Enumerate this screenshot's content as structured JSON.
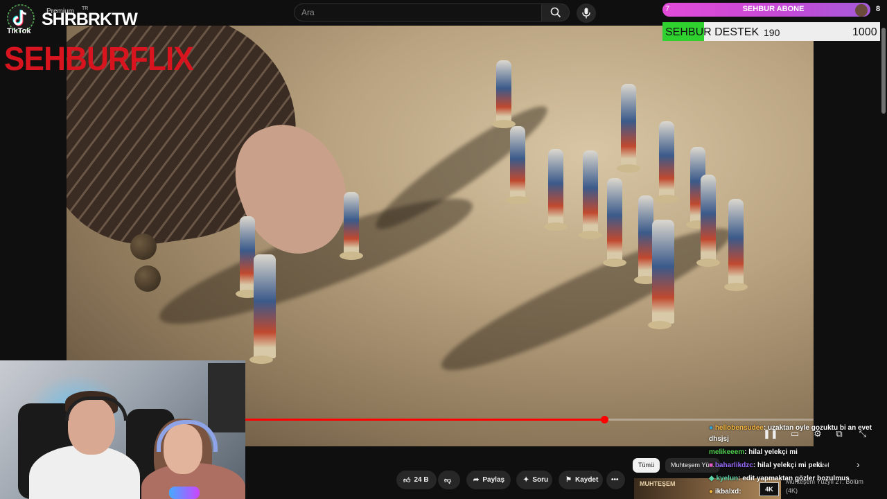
{
  "header": {
    "search_placeholder": "Ara",
    "search_icon": "search-icon",
    "mic_icon": "mic-icon"
  },
  "overlay": {
    "tiktok_name": "SHRBRKTW",
    "tiktok_premium": "Premium",
    "tiktok_tr": "TR",
    "tiktok_label": "TikTok",
    "brand": "SEHBURFLIX",
    "sub_goal": {
      "count": "7",
      "label": "SEHBUR ABONE",
      "target": "8"
    },
    "donation": {
      "label": "SEHBUR DESTEK",
      "value": "190",
      "goal": "1000",
      "fill_fraction": 0.19,
      "color": "#2ed12e"
    }
  },
  "player": {
    "progress_fraction": 0.632,
    "accent": "#ff0000"
  },
  "actions": {
    "like_count": "24 B",
    "share": "Paylaş",
    "ask": "Soru",
    "save": "Kaydet"
  },
  "chat": [
    {
      "user": "hellobensudee",
      "message": ": uzaktan oyle gozuktu bi an evet",
      "color": "#f5b53d"
    },
    {
      "user": "",
      "message": "dhsjsj",
      "color": "#ffffff"
    },
    {
      "user": "melikeeem",
      "message": ": hilal yelekçi mi",
      "color": "#52d152"
    },
    {
      "user": "baharlikdzc",
      "message": ": hilal yelekçi mi peki",
      "color": "#9a6cff"
    },
    {
      "user": "kyelun",
      "message": ": edit yapmaktan gözler bozulmus",
      "color": "#5cd6a8"
    },
    {
      "user": "ikbalxd",
      "message": ":",
      "color": "#ffffff"
    }
  ],
  "related": {
    "chip_all": "Tümü",
    "chip_series": "Muhteşem Yü...",
    "chip_special": "özel",
    "next_title": "Muhteşem Yüzyıl 27. Bölüm",
    "badge": "4K",
    "badge_small": "(4K)",
    "thumb_text": "MUHTEŞEM"
  }
}
